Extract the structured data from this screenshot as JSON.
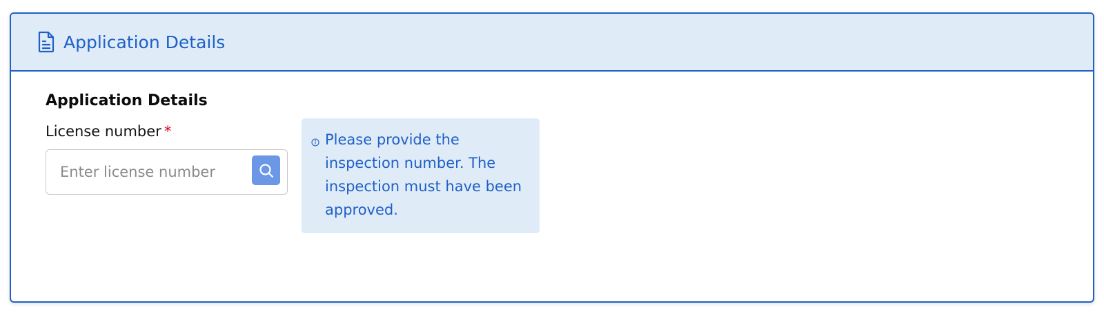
{
  "card": {
    "header_title": "Application Details",
    "header_icon": "document-icon"
  },
  "section": {
    "title": "Application Details"
  },
  "license_field": {
    "label": "License number",
    "required_marker": "*",
    "placeholder": "Enter license number",
    "value": "",
    "search_icon": "search-icon"
  },
  "info": {
    "icon": "info-icon",
    "text": "Please provide the inspection number. The inspection must have been approved."
  },
  "colors": {
    "accent": "#1f5fc7",
    "header_bg": "#dfecf8",
    "search_button": "#6b97e6",
    "required": "#d6001c"
  }
}
